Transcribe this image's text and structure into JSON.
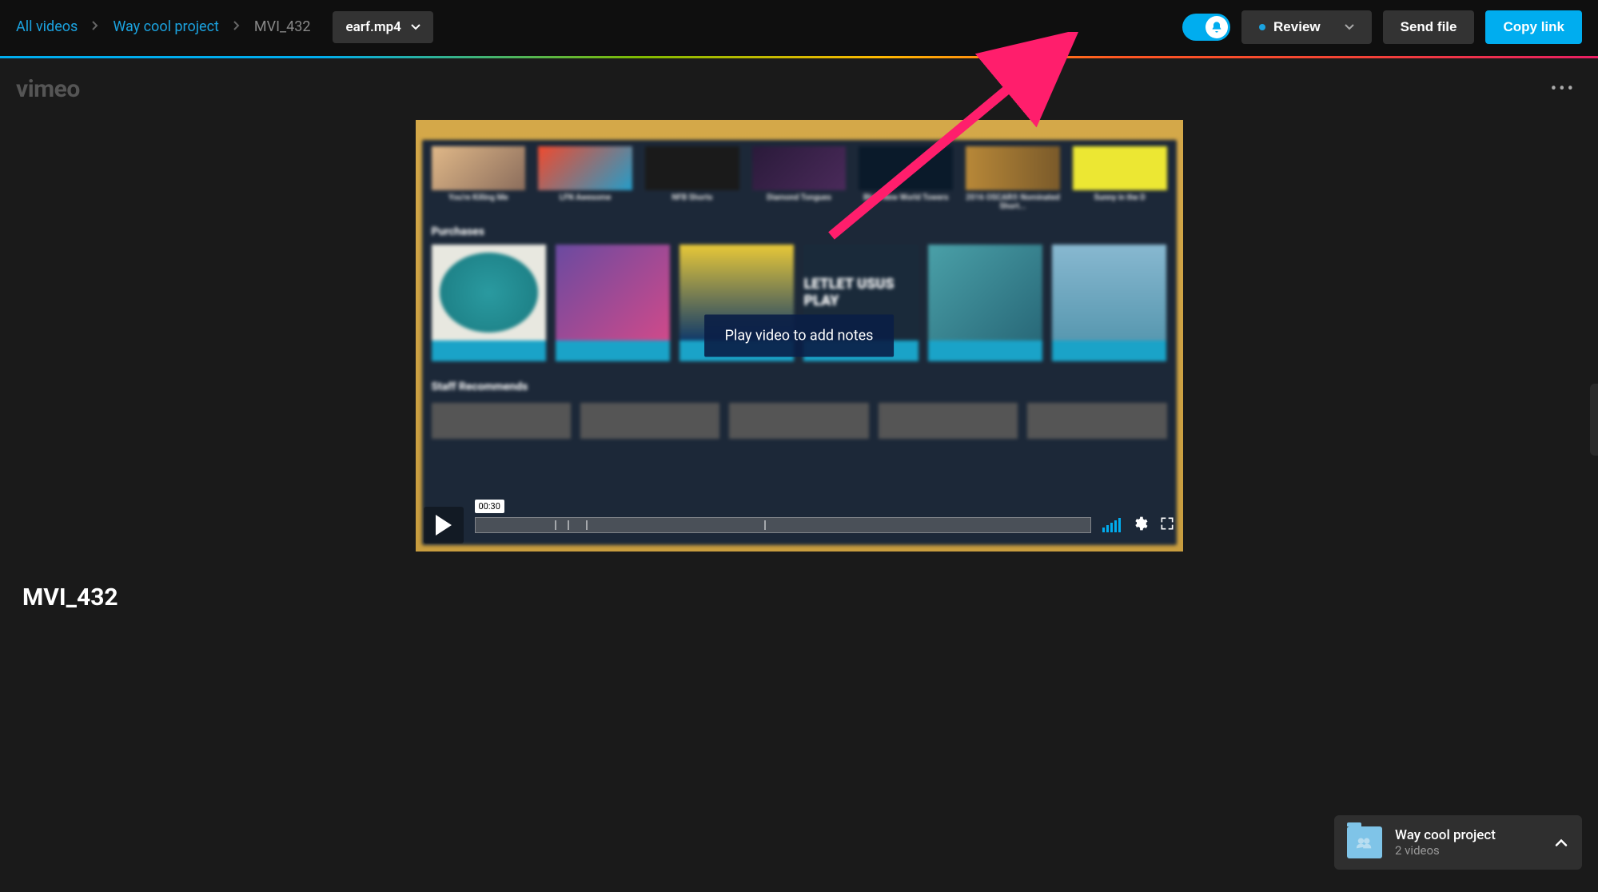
{
  "breadcrumb": {
    "root": "All videos",
    "project": "Way cool project",
    "video": "MVI_432"
  },
  "file_dropdown": {
    "label": "earf.mp4"
  },
  "topbar_buttons": {
    "review": "Review",
    "send_file": "Send file",
    "copy_link": "Copy link"
  },
  "logo": "vimeo",
  "overlay_hint": "Play video to add notes",
  "player": {
    "time": "00:30"
  },
  "video_title": "MVI_432",
  "project_card": {
    "name": "Way cool project",
    "count": "2 videos"
  },
  "inner_content": {
    "row1": [
      "You're Killing Me",
      "LFN Awesome",
      "NFB Shorts",
      "Diamond Tongues",
      "Blur: New World Towers",
      "2016 OSCAR® Nominated Short...",
      "Sunny in the D"
    ],
    "section_purchases": "Purchases",
    "section_staff": "Staff Recommends",
    "pi4_text": "LETLET USUS PLAY"
  }
}
